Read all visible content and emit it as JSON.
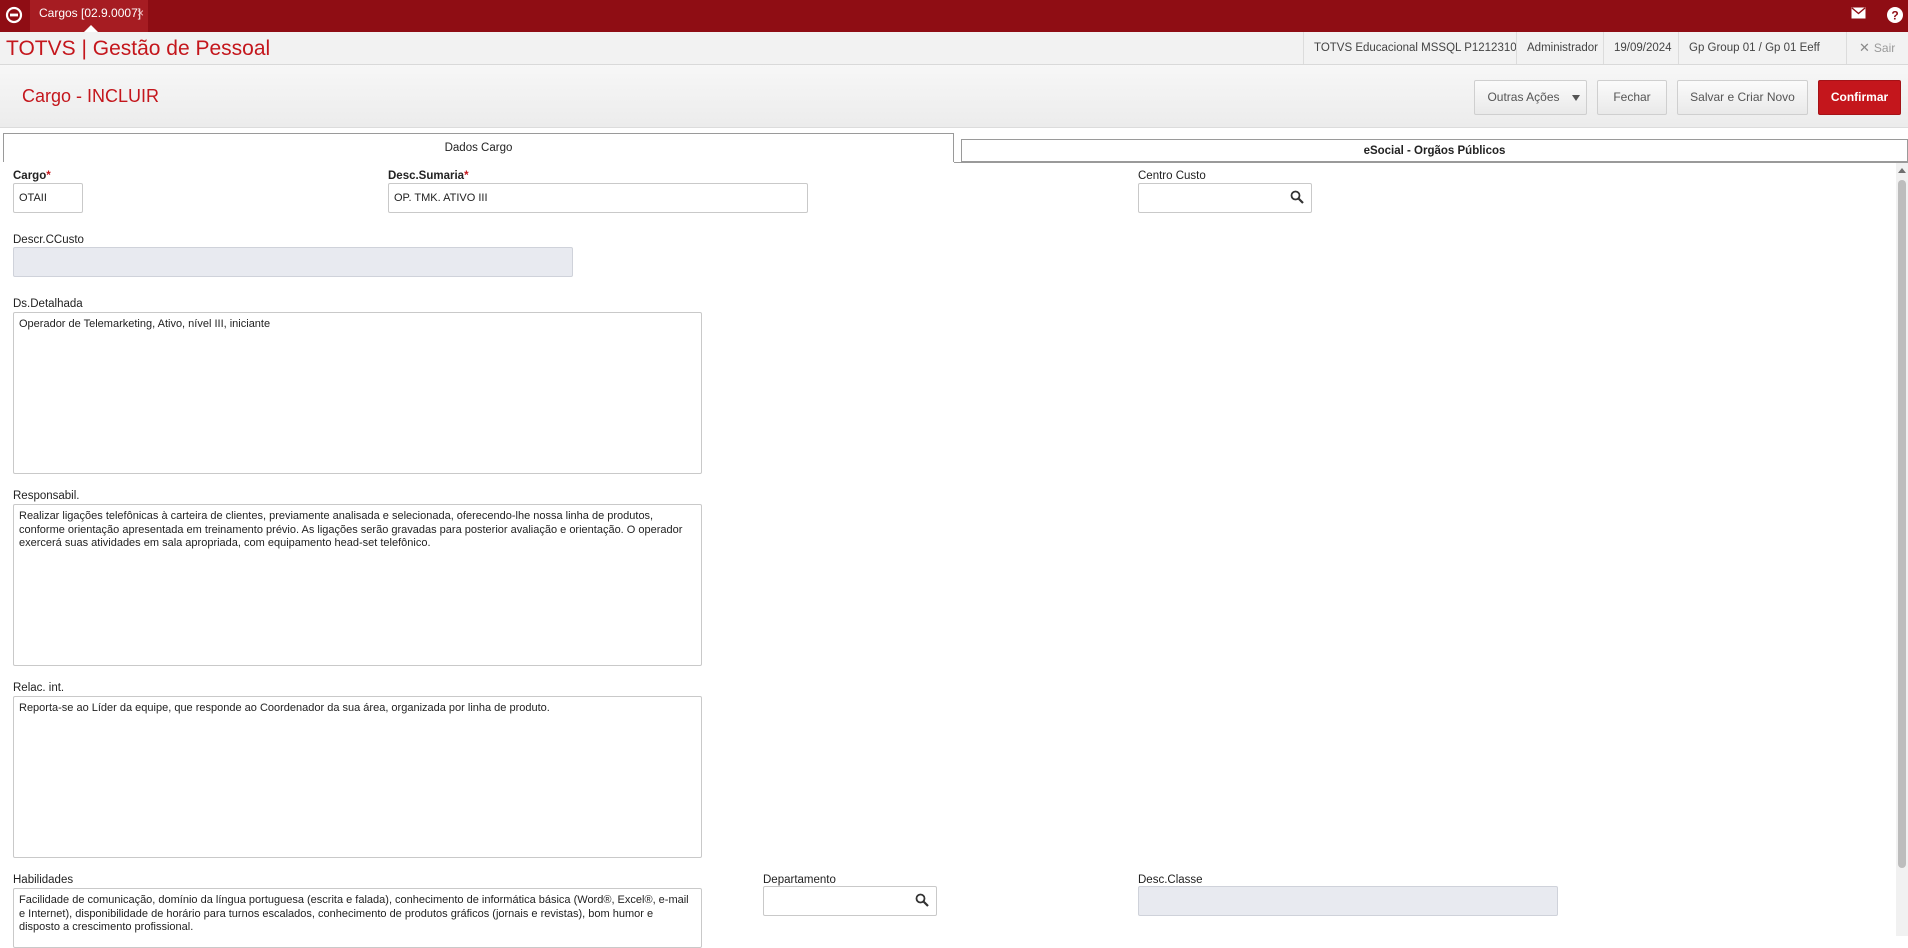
{
  "topbar": {
    "tab_label": "Cargos [02.9.0007]",
    "tab_close": "×",
    "icons": [
      "home-icon",
      "mail-icon",
      "help-icon"
    ]
  },
  "header": {
    "brand": "TOTVS | Gestão de Pessoal",
    "environment": "TOTVS Educacional MSSQL P1212310",
    "user": "Administrador",
    "date": "19/09/2024",
    "company": "Gp Group 01 / Gp 01 Eeff",
    "logout_label": "Sair"
  },
  "page": {
    "title": "Cargo - INCLUIR",
    "actions": {
      "other": "Outras Ações",
      "close": "Fechar",
      "save_new": "Salvar e Criar Novo",
      "confirm": "Confirmar"
    }
  },
  "tabs": [
    {
      "label": "Dados Cargo",
      "active": true
    },
    {
      "label": "eSocial - Orgãos Públicos",
      "active": false
    }
  ],
  "form": {
    "cargo": {
      "label": "Cargo",
      "required_mark": "*",
      "value": "OTAII"
    },
    "desc_sumaria": {
      "label": "Desc.Sumaria",
      "required_mark": "*",
      "value": "OP. TMK. ATIVO III"
    },
    "centro_custo": {
      "label": "Centro Custo",
      "value": ""
    },
    "descr_ccusto": {
      "label": "Descr.CCusto",
      "value": ""
    },
    "ds_detalhada": {
      "label": "Ds.Detalhada",
      "value": "Operador de Telemarketing, Ativo, nível III, iniciante"
    },
    "responsabil": {
      "label": "Responsabil.",
      "value": "Realizar ligações telefônicas à carteira de clientes, previamente analisada e selecionada, oferecendo-lhe nossa linha de produtos, conforme orientação apresentada em treinamento prévio. As ligações serão gravadas para posterior avaliação e orientação. O operador exercerá suas atividades em sala apropriada, com equipamento head-set telefônico."
    },
    "relac_int": {
      "label": "Relac. int.",
      "value": "Reporta-se ao Líder da equipe, que responde ao Coordenador da sua área, organizada por linha de produto."
    },
    "habilidades": {
      "label": "Habilidades",
      "value": "Facilidade de comunicação, domínio da língua portuguesa (escrita e falada), conhecimento de informática básica (Word®, Excel®, e-mail e Internet), disponibilidade de horário para turnos escalados, conhecimento de produtos gráficos (jornais e revistas), bom humor e disposto a crescimento profissional."
    },
    "departamento": {
      "label": "Departamento",
      "value": ""
    },
    "desc_classe": {
      "label": "Desc.Classe",
      "value": ""
    }
  },
  "colors": {
    "topbar": "#8f0d14",
    "brand_red": "#c4161c",
    "confirm_button": "#c4161c",
    "disabled_field": "#e8eaf0"
  }
}
